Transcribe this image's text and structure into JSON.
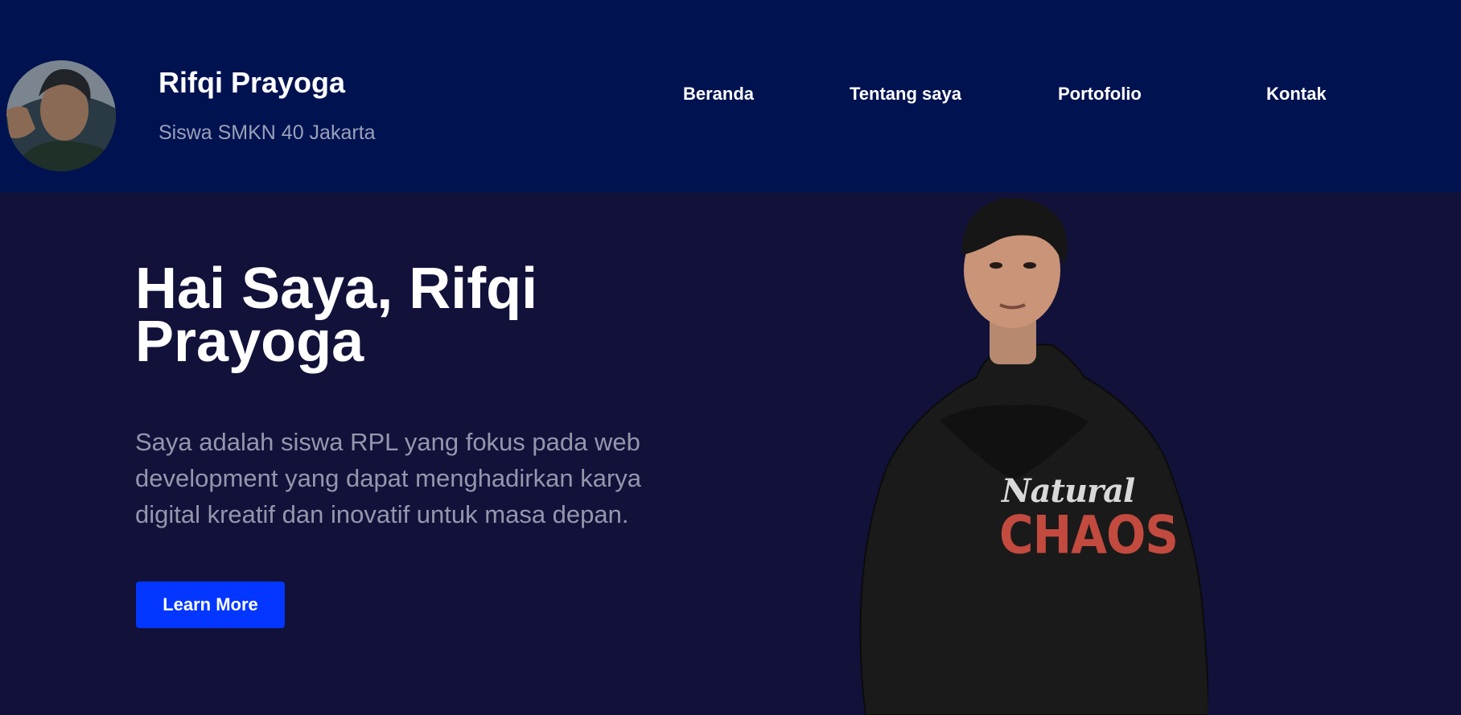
{
  "header": {
    "name": "Rifqi Prayoga",
    "subtitle": "Siswa SMKN 40 Jakarta",
    "avatar_alt": "profile photo",
    "nav": [
      {
        "label": "Beranda"
      },
      {
        "label": "Tentang saya"
      },
      {
        "label": "Portofolio"
      },
      {
        "label": "Kontak"
      }
    ]
  },
  "hero": {
    "title": "Hai Saya, Rifqi Prayoga",
    "description": "Saya adalah siswa RPL yang fokus pada web development yang dapat menghadirkan karya digital kreatif dan inovatif untuk masa depan.",
    "button_label": "Learn More",
    "portrait_shirt_text_top": "Natural",
    "portrait_shirt_text_bottom": "CHAOS"
  },
  "colors": {
    "header_bg": "#001250",
    "hero_bg": "#11113a",
    "accent": "#0336ff",
    "muted_text": "#9497ac"
  }
}
